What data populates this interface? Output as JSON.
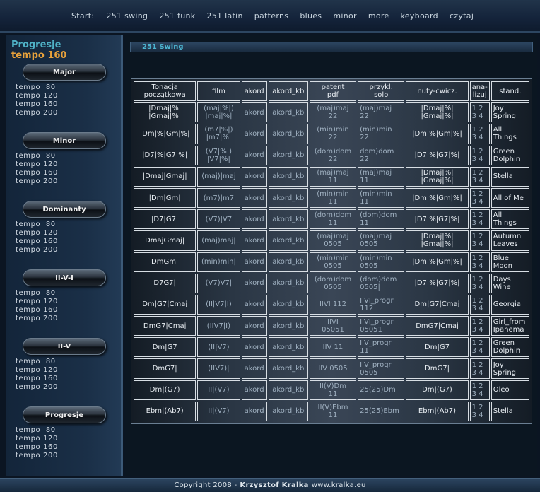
{
  "nav": {
    "start": "Start:",
    "items": [
      "251 swing",
      "251 funk",
      "251 latin",
      "patterns",
      "blues",
      "minor",
      "more",
      "keyboard",
      "czytaj"
    ]
  },
  "sidebar": {
    "title": "Progresje",
    "subtitle": "tempo 160",
    "groups": [
      {
        "label": "Major",
        "tempos": [
          "tempo  80",
          "tempo 120",
          "tempo 160",
          "tempo 200"
        ]
      },
      {
        "label": "Minor",
        "tempos": [
          "tempo  80",
          "tempo 120",
          "tempo 160",
          "tempo 200"
        ]
      },
      {
        "label": "Dominanty",
        "tempos": [
          "tempo  80",
          "tempo 120",
          "tempo 160",
          "tempo 200"
        ]
      },
      {
        "label": "II-V-I",
        "tempos": [
          "tempo  80",
          "tempo 120",
          "tempo 160",
          "tempo 200"
        ]
      },
      {
        "label": "II-V",
        "tempos": [
          "tempo  80",
          "tempo 120",
          "tempo 160",
          "tempo 200"
        ]
      },
      {
        "label": "Progresje",
        "tempos": [
          "tempo  80",
          "tempo 120",
          "tempo 160",
          "tempo 200"
        ]
      }
    ]
  },
  "main": {
    "crumb": "251 Swing",
    "headers": [
      [
        "Tonacja",
        "początkowa"
      ],
      [
        "film"
      ],
      [
        "akord"
      ],
      [
        "akord_kb"
      ],
      [
        "patent",
        "pdf"
      ],
      [
        "przykł.",
        "solo"
      ],
      [
        "nuty-ćwicz."
      ],
      [
        "ana-",
        "lizuj"
      ],
      [
        "stand."
      ]
    ],
    "rows": [
      [
        [
          "|Dmaj|%|",
          "|Gmaj|%|"
        ],
        [
          "(maj|%|)",
          "|maj|%|"
        ],
        [
          "akord"
        ],
        [
          "akord_kb"
        ],
        [
          "(maj)maj",
          "22"
        ],
        [
          "(maj)maj",
          "22"
        ],
        [
          "|Dmaj|%|",
          "|Gmaj|%|"
        ],
        [
          "1 2",
          "3 4"
        ],
        [
          "Joy",
          "Spring"
        ]
      ],
      [
        [
          "|Dm|%|Gm|%|"
        ],
        [
          "(m7|%|)",
          "|m7|%|"
        ],
        [
          "akord"
        ],
        [
          "akord_kb"
        ],
        [
          "(min)min",
          "22"
        ],
        [
          "(min)min",
          "22"
        ],
        [
          "|Dm|%|Gm|%|"
        ],
        [
          "1 2",
          "3 4"
        ],
        [
          "All",
          "Things"
        ]
      ],
      [
        [
          "|D7|%|G7|%|"
        ],
        [
          "(V7|%|)",
          "|V7|%|"
        ],
        [
          "akord"
        ],
        [
          "akord_kb"
        ],
        [
          "(dom)dom",
          "22"
        ],
        [
          "dom)dom",
          "22"
        ],
        [
          "|D7|%|G7|%|"
        ],
        [
          "1 2",
          "3 4"
        ],
        [
          "Green",
          "Dolphin"
        ]
      ],
      [
        [
          "|Dmaj|Gmaj|"
        ],
        [
          "(maj)|maj"
        ],
        [
          "akord"
        ],
        [
          "akord_kb"
        ],
        [
          "(maj)maj",
          "11"
        ],
        [
          "(maj)maj",
          "11"
        ],
        [
          "|Dmaj|%|",
          "|Gmaj|%|"
        ],
        [
          "1 2",
          "3 4"
        ],
        [
          "Stella"
        ]
      ],
      [
        [
          "|Dm|Gm|"
        ],
        [
          "(m7)|m7"
        ],
        [
          "akord"
        ],
        [
          "akord_kb"
        ],
        [
          "(min)min",
          "11"
        ],
        [
          "(min)min",
          "11"
        ],
        [
          "|Dm|%|Gm|%|"
        ],
        [
          "1 2",
          "3 4"
        ],
        [
          "All of Me"
        ]
      ],
      [
        [
          "|D7|G7|"
        ],
        [
          "(V7)|V7"
        ],
        [
          "akord"
        ],
        [
          "akord_kb"
        ],
        [
          "(dom)dom",
          "11"
        ],
        [
          "(dom)dom",
          "11"
        ],
        [
          "|D7|%|G7|%|"
        ],
        [
          "1 2",
          "3 4"
        ],
        [
          "All",
          "Things"
        ]
      ],
      [
        [
          "DmajGmaj|"
        ],
        [
          "(maj)maj|"
        ],
        [
          "akord"
        ],
        [
          "akord_kb"
        ],
        [
          "(maj)maj",
          "0505"
        ],
        [
          "(maj)maj",
          "0505"
        ],
        [
          "|Dmaj|%|",
          "|Gmaj|%|"
        ],
        [
          "1 2",
          "3 4"
        ],
        [
          "Autumn",
          "Leaves"
        ]
      ],
      [
        [
          "DmGm|"
        ],
        [
          "(min)min|"
        ],
        [
          "akord"
        ],
        [
          "akord_kb"
        ],
        [
          "(min)min",
          "0505"
        ],
        [
          "(min)min",
          "0505"
        ],
        [
          "|Dm|%|Gm|%|"
        ],
        [
          "1 2",
          "3 4"
        ],
        [
          "Blue",
          "Moon"
        ]
      ],
      [
        [
          "D7G7|"
        ],
        [
          "(V7)V7|"
        ],
        [
          "akord"
        ],
        [
          "akord_kb"
        ],
        [
          "(dom)dom",
          "0505"
        ],
        [
          "(dom)dom",
          "0505|"
        ],
        [
          "|D7|%|G7|%|"
        ],
        [
          "1 2",
          "3 4"
        ],
        [
          "Days",
          "Wine"
        ]
      ],
      [
        [
          "Dm|G7|Cmaj"
        ],
        [
          "(II|V7|I)"
        ],
        [
          "akord"
        ],
        [
          "akord_kb"
        ],
        [
          "IIVI 112"
        ],
        [
          "IIVI_progr",
          "112"
        ],
        [
          "Dm|G7|Cmaj"
        ],
        [
          "1 2",
          "3 4"
        ],
        [
          "Georgia"
        ]
      ],
      [
        [
          "DmG7|Cmaj"
        ],
        [
          "(IIV7|I)"
        ],
        [
          "akord"
        ],
        [
          "akord_kb"
        ],
        [
          "IIVI",
          "05051"
        ],
        [
          "IIVI_progr",
          "05051"
        ],
        [
          "DmG7|Cmaj"
        ],
        [
          "1 2",
          "3 4"
        ],
        [
          "Girl_from",
          "Ipanema"
        ]
      ],
      [
        [
          "Dm|G7"
        ],
        [
          "(II|V7)"
        ],
        [
          "akord"
        ],
        [
          "akord_kb"
        ],
        [
          "IIV 11"
        ],
        [
          "IIV_progr",
          "11"
        ],
        [
          "Dm|G7"
        ],
        [
          "1 2",
          "3 4"
        ],
        [
          "Green",
          "Dolphin"
        ]
      ],
      [
        [
          "DmG7|"
        ],
        [
          "(IIV7)|"
        ],
        [
          "akord"
        ],
        [
          "akord_kb"
        ],
        [
          "IIV 0505"
        ],
        [
          "IIV_progr",
          "0505"
        ],
        [
          "DmG7|"
        ],
        [
          "1 2",
          "3 4"
        ],
        [
          "Joy",
          "Spring"
        ]
      ],
      [
        [
          "Dm|(G7)"
        ],
        [
          "II|(V7)"
        ],
        [
          "akord"
        ],
        [
          "akord_kb"
        ],
        [
          "II(V)Dm",
          "11"
        ],
        [
          "25(25)Dm"
        ],
        [
          "Dm|(G7)"
        ],
        [
          "1 2",
          "3 4"
        ],
        [
          "Oleo"
        ]
      ],
      [
        [
          "Ebm|(Ab7)"
        ],
        [
          "II|(V7)"
        ],
        [
          "akord"
        ],
        [
          "akord_kb"
        ],
        [
          "II(V)Ebm",
          "11"
        ],
        [
          "25(25)Ebm"
        ],
        [
          "Ebm|(Ab7)"
        ],
        [
          "1 2",
          "3 4"
        ],
        [
          "Stella"
        ]
      ]
    ]
  },
  "footer": {
    "prefix": "Copyright 2008 -",
    "author": "Krzysztof Kralka",
    "site": "www.kralka.eu"
  }
}
